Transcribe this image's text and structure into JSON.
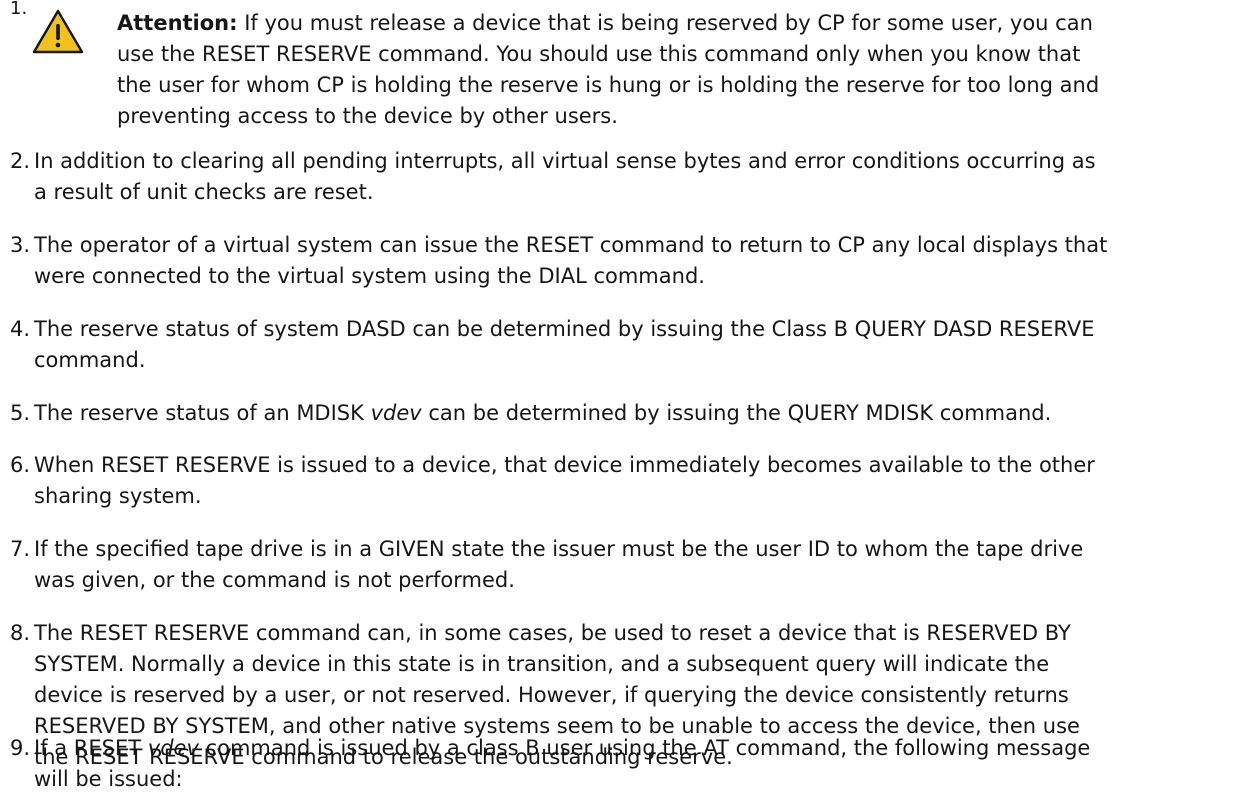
{
  "items": [
    {
      "num": "1.",
      "label": "Attention:",
      "lines": [
        " If you must release a device that is being reserved by CP for some user, you can",
        "use the RESET RESERVE command. You should use this command only when you know that",
        "the user for whom CP is holding the reserve is hung or is holding the reserve for too long and",
        "preventing access to the device by other users."
      ]
    },
    {
      "num": "2.",
      "lines": [
        "In addition to clearing all pending interrupts, all virtual sense bytes and error conditions occurring as",
        "a result of unit checks are reset."
      ]
    },
    {
      "num": "3.",
      "lines": [
        "The operator of a virtual system can issue the RESET command to return to CP any local displays that",
        "were connected to the virtual system using the DIAL command."
      ]
    },
    {
      "num": "4.",
      "lines": [
        "The reserve status of system DASD can be determined by issuing the Class B QUERY DASD RESERVE",
        "command."
      ]
    },
    {
      "num": "5.",
      "pre": "The reserve status of an MDISK ",
      "em": "vdev",
      "post": " can be determined by issuing the QUERY MDISK command."
    },
    {
      "num": "6.",
      "lines": [
        "When RESET RESERVE is issued to a device, that device immediately becomes available to the other",
        "sharing system."
      ]
    },
    {
      "num": "7.",
      "lines": [
        "If the specified tape drive is in a GIVEN state the issuer must be the user ID to whom the tape drive",
        "was given, or the command is not performed."
      ]
    },
    {
      "num": "8.",
      "lines": [
        "The RESET RESERVE command can, in some cases, be used to reset a device that is RESERVED BY",
        "SYSTEM. Normally a device in this state is in transition, and a subsequent query will indicate the",
        "device is reserved by a user, or not reserved. However, if querying the device consistently returns",
        "RESERVED BY SYSTEM, and other native systems seem to be unable to access the device, then use",
        "the RESET RESERVE command to release the outstanding reserve."
      ]
    },
    {
      "num": "9.",
      "pre": "If a RESET ",
      "em": "vdev",
      "post": " command is issued by a class B user using the AT command, the following message",
      "line2": "will be issued:"
    }
  ],
  "icons": {
    "attention": "warning-triangle-icon",
    "attention_color": "#f1c21b"
  }
}
